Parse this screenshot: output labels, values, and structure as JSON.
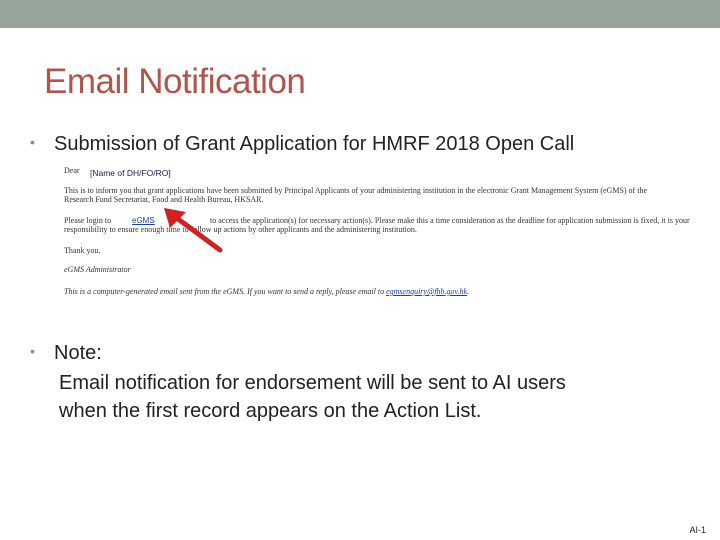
{
  "slide": {
    "title": "Email Notification",
    "bullet_1": "Submission of Grant Application for HMRF 2018 Open Call",
    "bullet_2": "Note:",
    "note_line_1": "Email notification for endorsement will be sent to AI users",
    "note_line_2": "when the first record appears on the Action List.",
    "slide_number": "AI-1"
  },
  "email": {
    "salutation": "Dear",
    "recipient_placeholder": "[Name of DH/FO/RO]",
    "line_1": "This is to inform you that grant applications have been submitted by Principal Applicants of your administering institution in the electronic Grant Management System (eGMS) of the",
    "line_2": "Research Fund Secretariat, Food and Health Bureau, HKSAR.",
    "line_3_start": "Please login to",
    "egms_link": "eGMS",
    "line_3_end": "to access the application(s) for necessary action(s). Please make this a time consideration as the deadline for application submission is fixed, it is your",
    "line_4": "responsibility to ensure enough time to follow up actions by other applicants and the administering institution.",
    "thank_you": "Thank you.",
    "signature": "eGMS Administrator",
    "footer_text": "This is a computer-generated email sent from the eGMS. If you want to send a reply, please email to",
    "footer_email": "egmsenquiry@fhb.gov.hk",
    "footer_end": "."
  },
  "colors": {
    "top_bar": "#97A69A",
    "title": "#B0554B",
    "arrow": "#D42020",
    "link": "#1a3fb0"
  }
}
